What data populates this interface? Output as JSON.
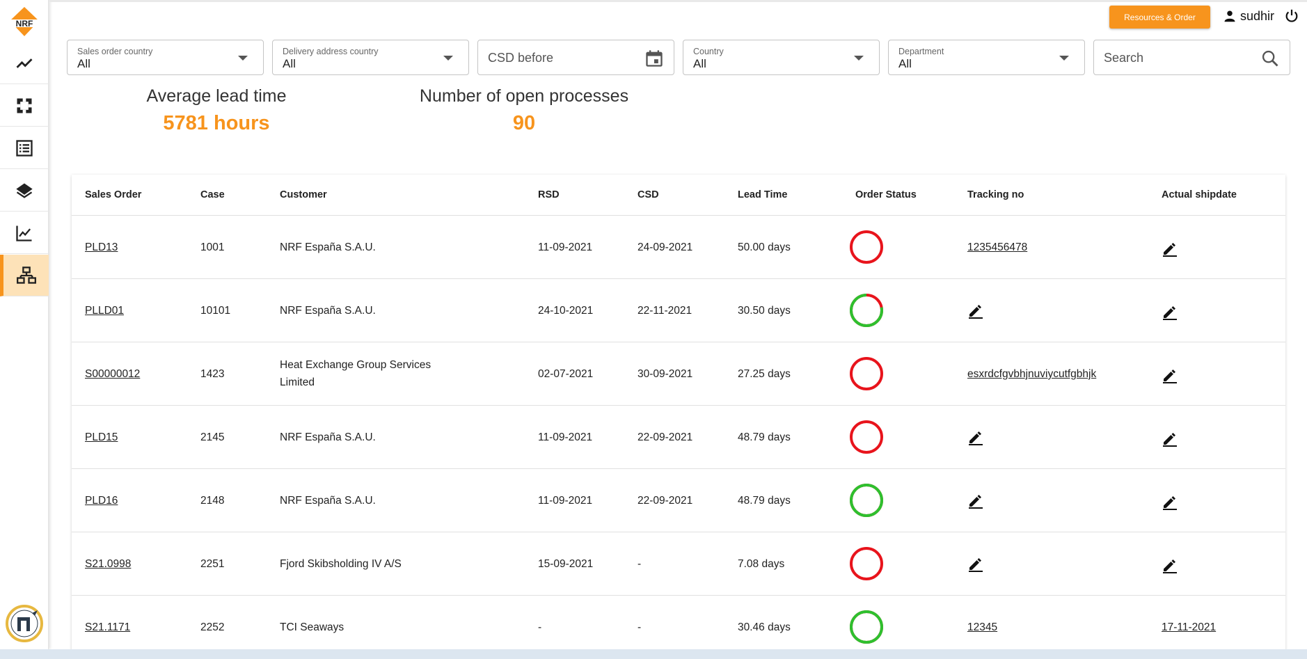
{
  "brand": {
    "logo_text": "NRF",
    "accent": "#f7941d"
  },
  "nav": [
    {
      "icon": "trend-line-icon"
    },
    {
      "icon": "focus-frame-icon"
    },
    {
      "icon": "list-icon"
    },
    {
      "icon": "layers-icon"
    },
    {
      "icon": "chart-icon"
    },
    {
      "icon": "sitemap-icon",
      "active": true
    }
  ],
  "header": {
    "resources_label": "Resources & Order",
    "username": "sudhir"
  },
  "filters": {
    "sales_order_country": {
      "label": "Sales order country",
      "value": "All"
    },
    "delivery_address_country": {
      "label": "Delivery address country",
      "value": "All"
    },
    "csd_before": {
      "placeholder": "CSD before"
    },
    "country": {
      "label": "Country",
      "value": "All"
    },
    "department": {
      "label": "Department",
      "value": "All"
    },
    "search": {
      "placeholder": "Search"
    }
  },
  "kpis": {
    "lead_time": {
      "label": "Average lead time",
      "value": "5781 hours"
    },
    "open_processes": {
      "label": "Number of open processes",
      "value": "90"
    }
  },
  "table": {
    "columns": [
      "Sales Order",
      "Case",
      "Customer",
      "RSD",
      "CSD",
      "Lead Time",
      "Order Status",
      "Tracking no",
      "Actual shipdate"
    ],
    "rows": [
      {
        "sales_order": "PLD13",
        "case": "1001",
        "customer": [
          "NRF España S.A.U."
        ],
        "rsd": "11-09-2021",
        "csd": "24-09-2021",
        "lead_time": "50.00 days",
        "status_green": 0,
        "tracking": "1235456478",
        "shipdate": ""
      },
      {
        "sales_order": "PLLD01",
        "case": "10101",
        "customer": [
          "NRF España S.A.U."
        ],
        "rsd": "24-10-2021",
        "csd": "22-11-2021",
        "lead_time": "30.50 days",
        "status_green": 0.78,
        "tracking": "",
        "shipdate": ""
      },
      {
        "sales_order": "S00000012",
        "case": "1423",
        "customer": [
          "Heat Exchange Group Services",
          "Limited"
        ],
        "rsd": "02-07-2021",
        "csd": "30-09-2021",
        "lead_time": "27.25 days",
        "status_green": 0,
        "tracking": "esxrdcfgvbhjnuviycutfgbhjk",
        "shipdate": ""
      },
      {
        "sales_order": "PLD15",
        "case": "2145",
        "customer": [
          "NRF España S.A.U."
        ],
        "rsd": "11-09-2021",
        "csd": "22-09-2021",
        "lead_time": "48.79 days",
        "status_green": 0,
        "tracking": "",
        "shipdate": ""
      },
      {
        "sales_order": "PLD16",
        "case": "2148",
        "customer": [
          "NRF España S.A.U."
        ],
        "rsd": "11-09-2021",
        "csd": "22-09-2021",
        "lead_time": "48.79 days",
        "status_green": 1,
        "tracking": "",
        "shipdate": ""
      },
      {
        "sales_order": "S21.0998",
        "case": "2251",
        "customer": [
          "Fjord Skibsholding IV A/S"
        ],
        "rsd": "15-09-2021",
        "csd": "-",
        "lead_time": "7.08 days",
        "status_green": 0,
        "tracking": "",
        "shipdate": ""
      },
      {
        "sales_order": "S21.1171",
        "case": "2252",
        "customer": [
          "TCI Seaways"
        ],
        "rsd": "-",
        "csd": "-",
        "lead_time": "30.46 days",
        "status_green": 1,
        "tracking": "12345",
        "shipdate": "17-11-2021"
      }
    ]
  },
  "status_colors": {
    "green": "#2ec02e",
    "red": "#e8141c"
  }
}
